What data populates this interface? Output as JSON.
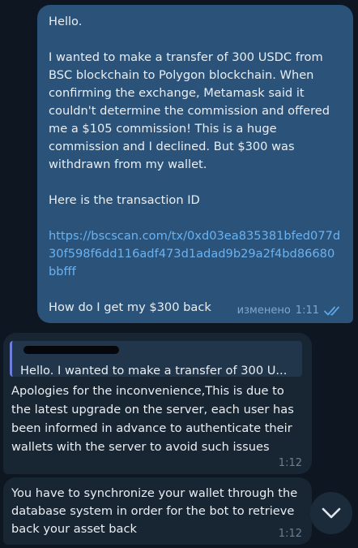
{
  "outgoing": {
    "greeting": "Hello.",
    "body": "I wanted to make a transfer of 300 USDC from BSC blockchain to Polygon blockchain. When confirming the exchange, Metamask said it couldn't determine the commission and offered me a $105 commission! This is a huge commission and I declined. But $300 was withdrawn from my wallet.",
    "tx_intro": "Here is the transaction ID",
    "link": "https://bscscan.com/tx/0xd03ea835381bfed077d30f598f6dd116adf473d1adad9b29a2f4bd86680bbfff",
    "question": "How do I get my $300 back",
    "edited_label": "изменено",
    "time": "1:11",
    "status_icon": "double-check-icon",
    "colors": {
      "bubble": "#2b5278",
      "link": "#6ab3f3"
    }
  },
  "reply_message": {
    "quote_sender": "",
    "quote_text": "Hello.  I wanted to make a transfer of 300 U...",
    "text": "Apologies for the inconvenience,This is due to the latest upgrade on the server, each user has been informed in advance to authenticate their wallets with the server to avoid such issues",
    "time": "1:12"
  },
  "second_message": {
    "text": "You have to synchronize your wallet through the database system in order for the bot to retrieve back your asset back",
    "time": "1:12"
  },
  "scroll_button": {
    "icon": "chevron-down-icon"
  }
}
